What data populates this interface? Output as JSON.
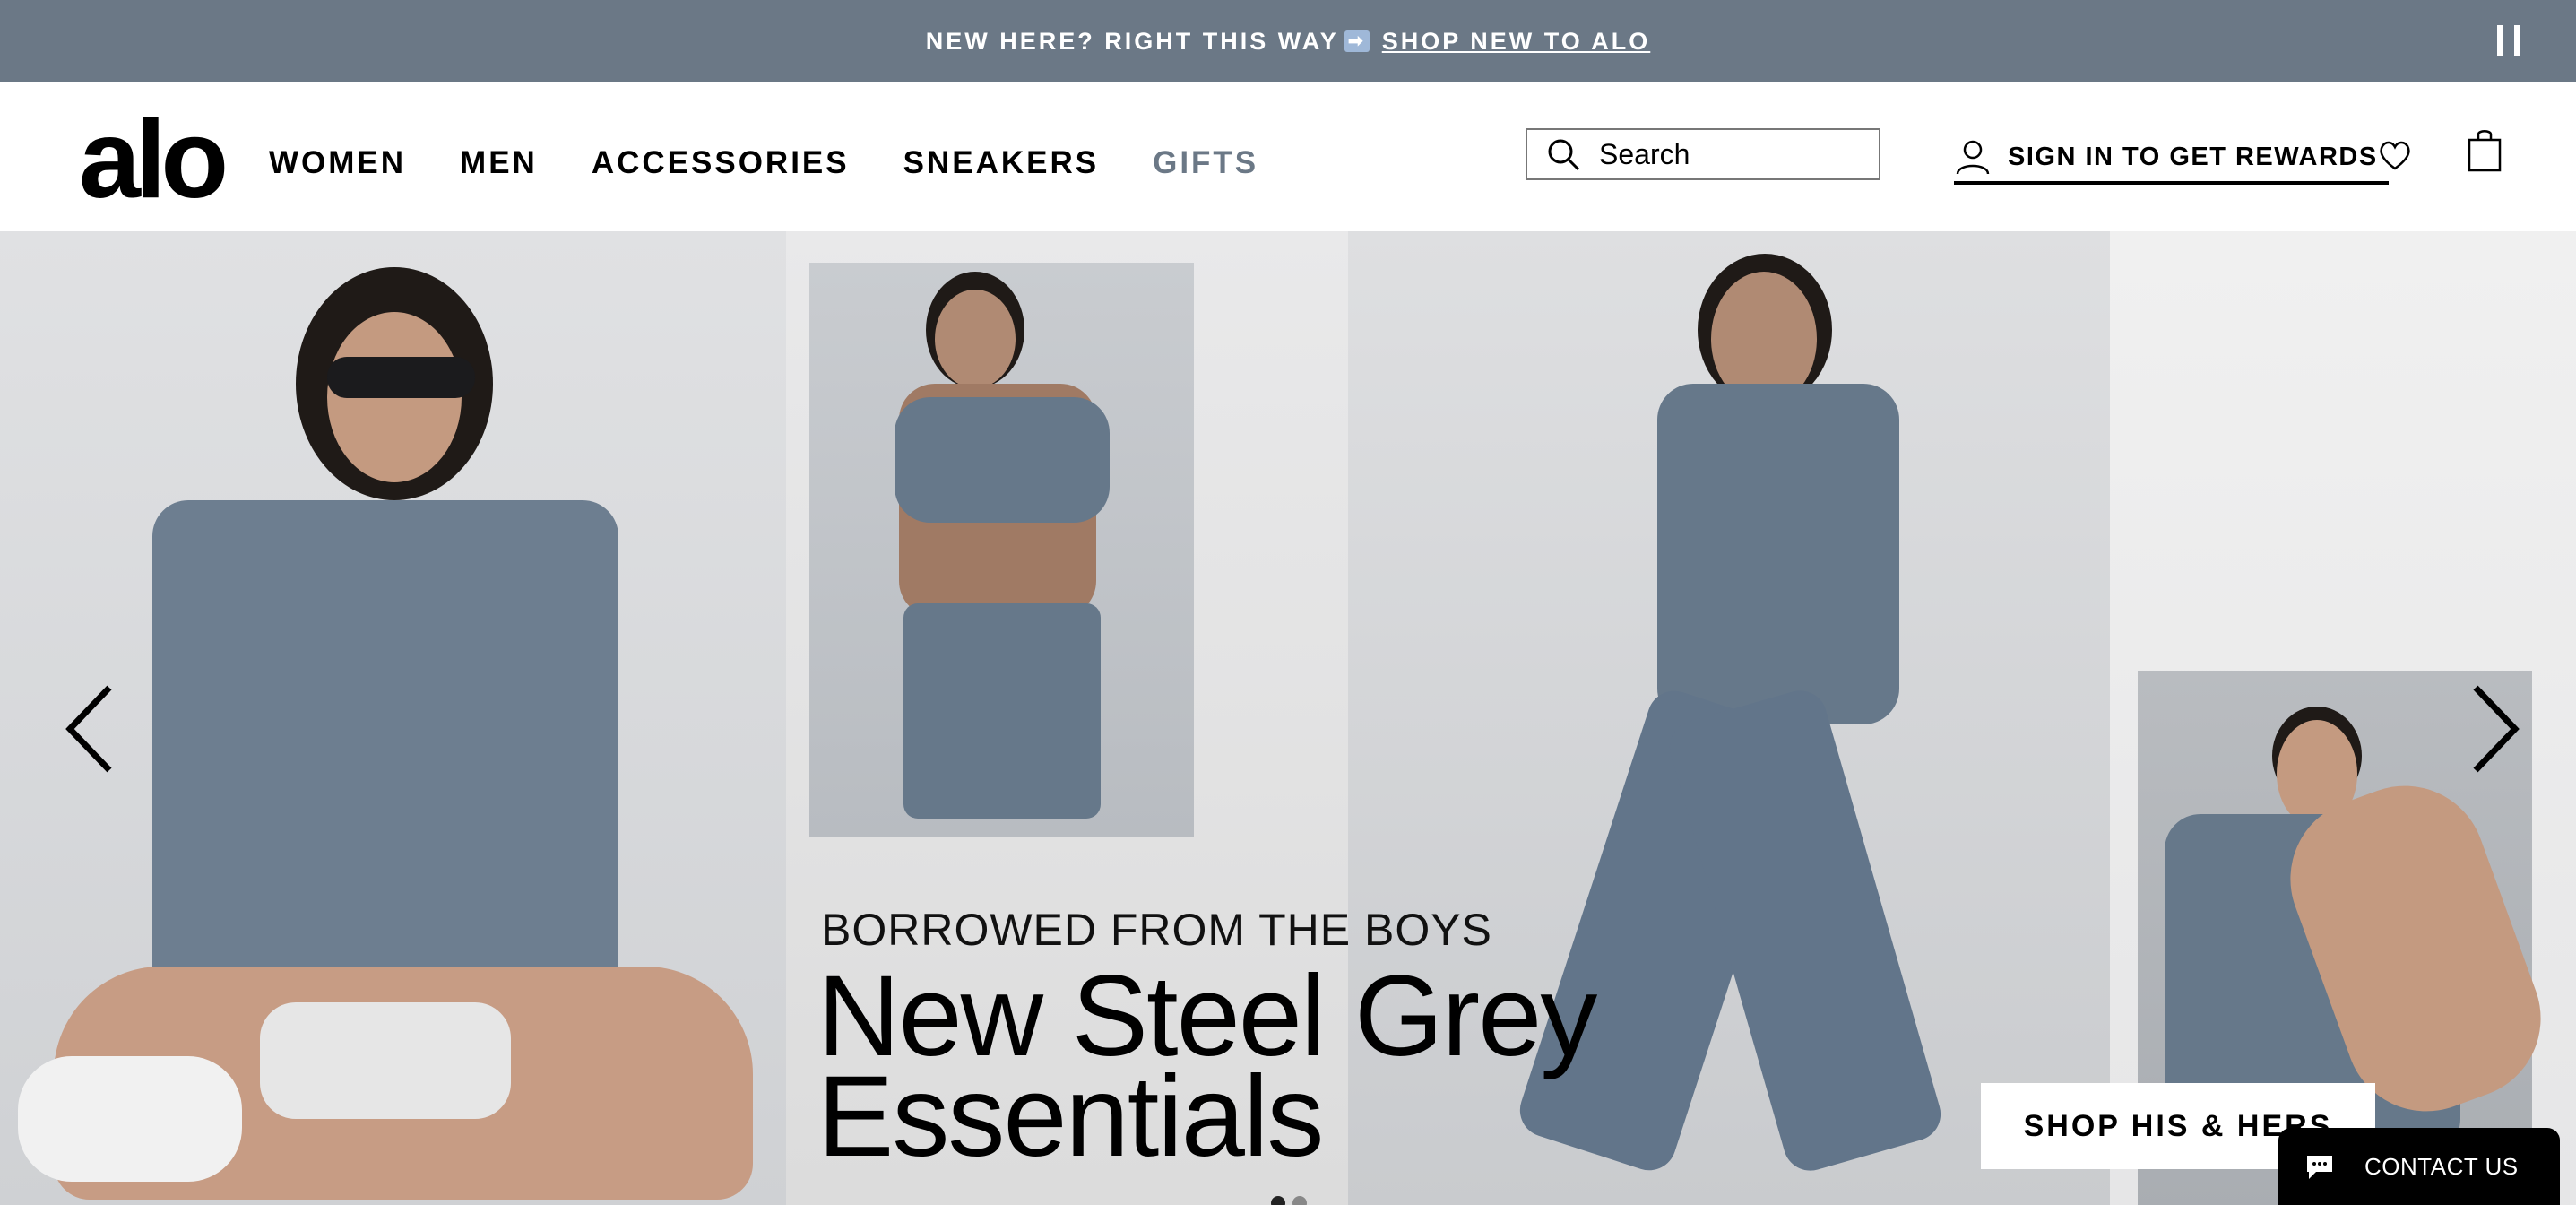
{
  "announcement": {
    "text": "NEW HERE? RIGHT THIS WAY",
    "arrow_icon": "right-arrow-emoji-icon",
    "link": "SHOP NEW TO ALO",
    "pause_icon": "pause-icon"
  },
  "header": {
    "logo": "alo",
    "nav": [
      "WOMEN",
      "MEN",
      "ACCESSORIES",
      "SNEAKERS",
      "GIFTS"
    ],
    "search_placeholder": "Search",
    "signin": "SIGN IN TO GET REWARDS"
  },
  "hero": {
    "eyebrow": "BORROWED FROM THE BOYS",
    "headline_line1": "New Steel Grey",
    "headline_line2": "Essentials",
    "cta": "SHOP HIS & HERS",
    "slide_count": 2,
    "active_slide": 1
  },
  "contact": {
    "label": "CONTACT US"
  },
  "colors": {
    "announce_bg": "#6b7886",
    "gifts": "#6b7886",
    "apparel": "#66788a"
  }
}
